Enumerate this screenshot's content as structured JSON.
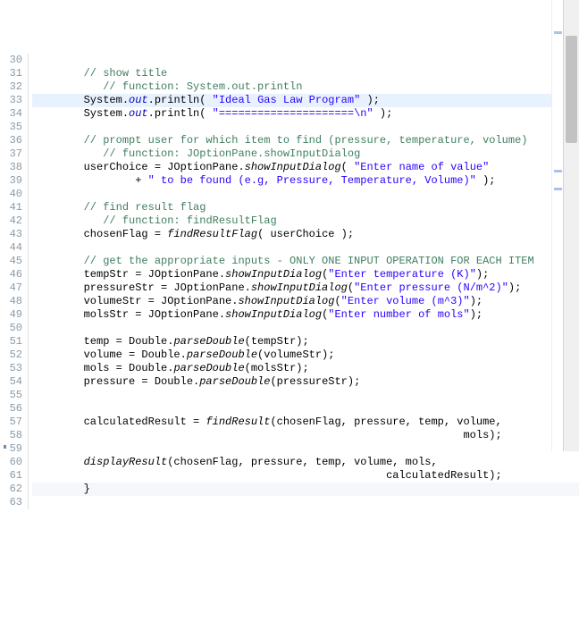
{
  "lines": [
    {
      "n": 30,
      "html": ""
    },
    {
      "n": 31,
      "html": "        <span class='cm'>// show title</span>"
    },
    {
      "n": 32,
      "html": "           <span class='cm'>// function: System.out.println</span>"
    },
    {
      "n": 33,
      "hl": true,
      "html": "        System.<span class='fld'>out</span>.println( <span class='str'>\"Ideal Gas Law Program\"</span> );"
    },
    {
      "n": 34,
      "html": "        System.<span class='fld'>out</span>.println( <span class='str'>\"=====================\\n\"</span> );"
    },
    {
      "n": 35,
      "html": ""
    },
    {
      "n": 36,
      "html": "        <span class='cm'>// prompt user for which item to find (pressure, temperature, volume)</span>"
    },
    {
      "n": 37,
      "html": "           <span class='cm'>// function: JOptionPane.showInputDialog</span>"
    },
    {
      "n": 38,
      "html": "        userChoice = JOptionPane.<span class='mth'>showInputDialog</span>( <span class='str'>\"Enter name of value\"</span>"
    },
    {
      "n": 39,
      "html": "                + <span class='str'>\" to be found (e.g, Pressure, Temperature, Volume)\"</span> );"
    },
    {
      "n": 40,
      "html": ""
    },
    {
      "n": 41,
      "html": "        <span class='cm'>// find result flag</span>"
    },
    {
      "n": 42,
      "html": "           <span class='cm'>// function: findResultFlag</span>"
    },
    {
      "n": 43,
      "html": "        chosenFlag = <span class='mth'>findResultFlag</span>( userChoice );"
    },
    {
      "n": 44,
      "html": ""
    },
    {
      "n": 45,
      "html": "        <span class='cm'>// get the appropriate inputs - ONLY ONE INPUT OPERATION FOR EACH ITEM</span>"
    },
    {
      "n": 46,
      "html": "        tempStr = JOptionPane.<span class='mth'>showInputDialog</span>(<span class='str'>\"Enter temperature (K)\"</span>);"
    },
    {
      "n": 47,
      "html": "        pressureStr = JOptionPane.<span class='mth'>showInputDialog</span>(<span class='str'>\"Enter pressure (N/m^2)\"</span>);"
    },
    {
      "n": 48,
      "html": "        volumeStr = JOptionPane.<span class='mth'>showInputDialog</span>(<span class='str'>\"Enter volume (m^3)\"</span>);"
    },
    {
      "n": 49,
      "html": "        molsStr = JOptionPane.<span class='mth'>showInputDialog</span>(<span class='str'>\"Enter number of mols\"</span>);"
    },
    {
      "n": 50,
      "html": ""
    },
    {
      "n": 51,
      "html": "        temp = Double.<span class='mth'>parseDouble</span>(tempStr);"
    },
    {
      "n": 52,
      "html": "        volume = Double.<span class='mth'>parseDouble</span>(volumeStr);"
    },
    {
      "n": 53,
      "html": "        mols = Double.<span class='mth'>parseDouble</span>(molsStr);"
    },
    {
      "n": 54,
      "html": "        pressure = Double.<span class='mth'>parseDouble</span>(pressureStr);"
    },
    {
      "n": 55,
      "html": ""
    },
    {
      "n": 56,
      "html": ""
    },
    {
      "n": 57,
      "html": "        calculatedResult = <span class='mth'>findResult</span>(chosenFlag, pressure, temp, volume,"
    },
    {
      "n": 58,
      "html": "                                                                   mols);"
    },
    {
      "n": 59,
      "html": ""
    },
    {
      "n": 60,
      "html": "        <span class='mth'>displayResult</span>(chosenFlag, pressure, temp, volume, mols,"
    },
    {
      "n": 61,
      "html": "                                                       calculatedResult);"
    },
    {
      "n": 62,
      "cur": true,
      "html": "        }"
    },
    {
      "n": 63,
      "html": ""
    }
  ],
  "overview_marks": [
    35,
    190,
    210
  ]
}
